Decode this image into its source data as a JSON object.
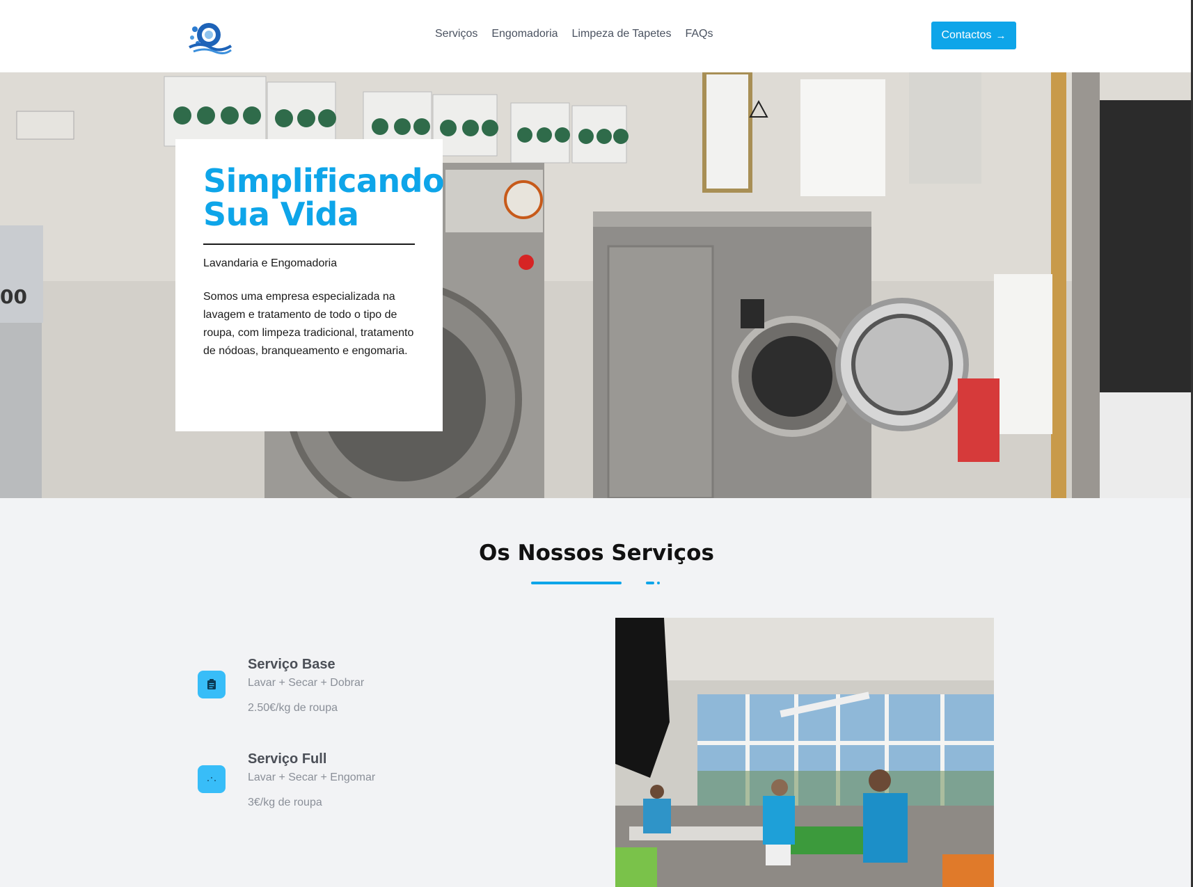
{
  "header": {
    "logo_icon": "laundry-logo",
    "nav": [
      "Serviços",
      "Engomadoria",
      "Limpeza de Tapetes",
      "FAQs"
    ],
    "contact_label": "Contactos",
    "contact_icon": "arrow-right-icon"
  },
  "hero": {
    "title_line1": "Simplificando",
    "title_line2": "Sua Vida",
    "subtitle": "Lavandaria e Engomadoria",
    "description": "Somos uma empresa especializada na lavagem e tratamento de todo o tipo de roupa, com limpeza tradicional, tratamento de nódoas, branqueamento e engomaria."
  },
  "services": {
    "title": "Os Nossos Serviços",
    "items": [
      {
        "name": "Serviço Base",
        "desc": "Lavar + Secar + Dobrar",
        "price": "2.50€/kg de roupa",
        "icon": "clipboard-icon"
      },
      {
        "name": "Serviço Full",
        "desc": "Lavar + Secar + Engomar",
        "price": "3€/kg de roupa",
        "icon": "iron-icon"
      }
    ]
  },
  "colors": {
    "accent": "#0ea5e9",
    "icon_bg": "#38bdf8",
    "page_bg": "#f2f3f5"
  }
}
